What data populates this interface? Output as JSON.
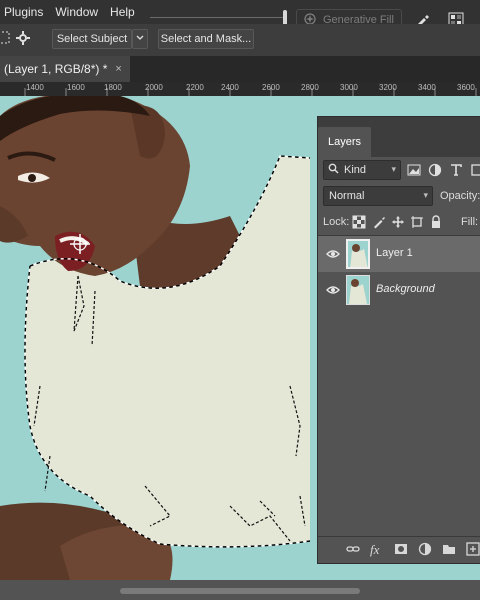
{
  "menu": [
    "Plugins",
    "Window",
    "Help"
  ],
  "generative_fill": {
    "label": "Generative Fill",
    "icon": "sparkle-icon"
  },
  "options_bar": {
    "select_subject": "Select Subject",
    "select_and_mask": "Select and Mask..."
  },
  "document_tab": {
    "title": "(Layer 1, RGB/8*) *",
    "close": "×"
  },
  "ruler": {
    "ticks": [
      "1400",
      "1600",
      "1800",
      "2000",
      "2200",
      "2400",
      "2600",
      "2800",
      "3000",
      "3200",
      "3400",
      "3600"
    ]
  },
  "layers_panel": {
    "tab": "Layers",
    "kind": "Kind",
    "blend_mode": "Normal",
    "opacity_label": "Opacity:",
    "lock_label": "Lock:",
    "fill_label": "Fill:",
    "layers": [
      {
        "name": "Layer 1",
        "selected": true,
        "italic": false
      },
      {
        "name": "Background",
        "selected": false,
        "italic": true
      }
    ],
    "bottom_icons": [
      "link-icon",
      "fx-icon",
      "mask-icon",
      "adjustment-icon",
      "group-folder-icon",
      "new-layer-icon"
    ],
    "fx_label": "fx"
  },
  "colors": {
    "canvas_bg": "#9cd3cf",
    "shirt": "#e4e7d6",
    "skin": "#6b4331",
    "panel": "#535353",
    "menubar": "#323232"
  }
}
